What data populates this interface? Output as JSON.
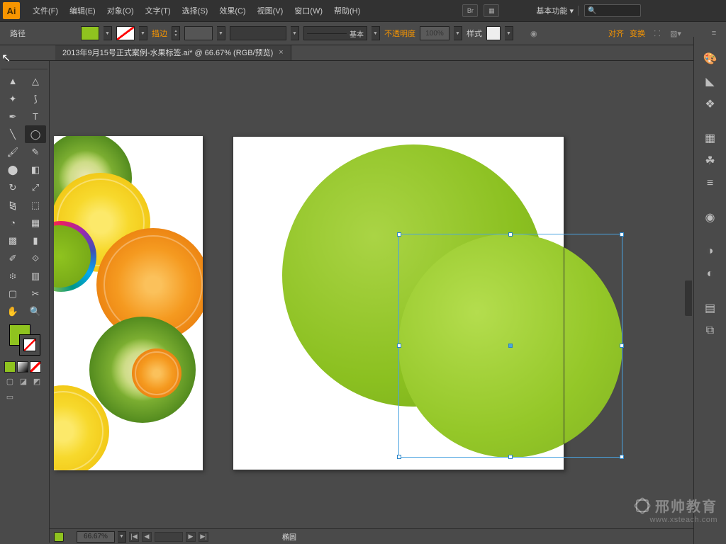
{
  "app": {
    "logo": "Ai"
  },
  "menu": {
    "file": "文件(F)",
    "edit": "编辑(E)",
    "object": "对象(O)",
    "type": "文字(T)",
    "select": "选择(S)",
    "effect": "效果(C)",
    "view": "视图(V)",
    "window": "窗口(W)",
    "help": "帮助(H)"
  },
  "menubar_right": {
    "br": "Br",
    "workspace": "基本功能"
  },
  "control": {
    "selection": "路径",
    "stroke_label": "描边",
    "brush_label": "基本",
    "opacity_label": "不透明度",
    "opacity_value": "100%",
    "style_label": "样式",
    "align_label": "对齐",
    "transform_label": "变换"
  },
  "tab": {
    "title": "2013年9月15号正式案例-水果标签.ai* @ 66.67% (RGB/预览)"
  },
  "status": {
    "zoom": "66.67%",
    "selection": "椭圆"
  },
  "watermark": {
    "brand": "邢帅教育",
    "url": "www.xsteach.com"
  },
  "colors": {
    "fill": "#8fc31f",
    "accent": "#f79500",
    "panel": "#4a4a4a",
    "selection_blue": "#4aa3e0"
  },
  "dock": {
    "icons": [
      "color-panel",
      "color-guide",
      "swatches",
      "brushes",
      "symbols",
      "stroke",
      "gradient",
      "transparency",
      "appearance",
      "graphic-styles",
      "layers",
      "artboards"
    ]
  }
}
